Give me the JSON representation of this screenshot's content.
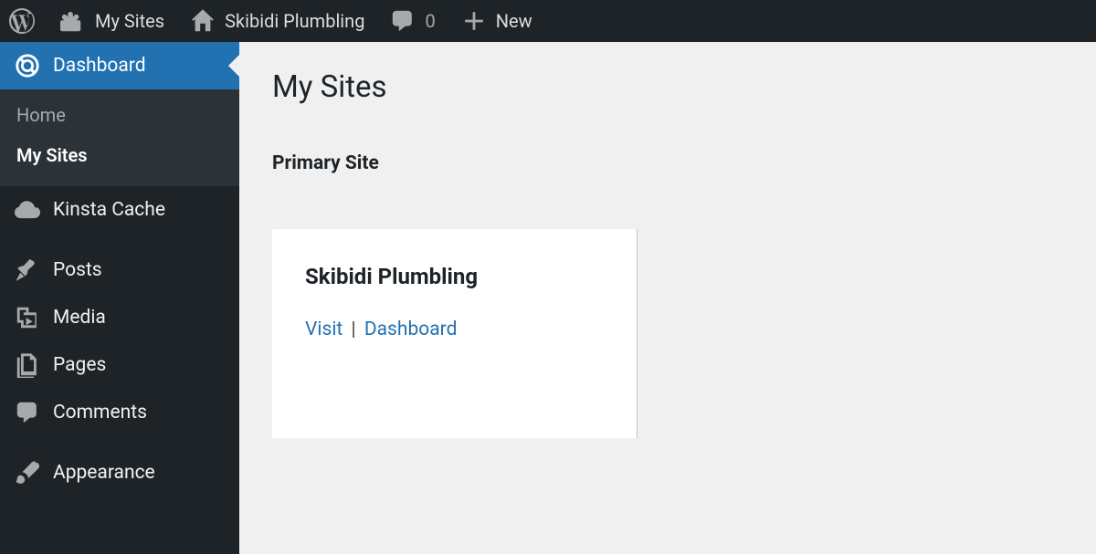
{
  "adminbar": {
    "my_sites": "My Sites",
    "site_name": "Skibidi Plumbling",
    "comments_count": "0",
    "new": "New"
  },
  "sidebar": {
    "dashboard": "Dashboard",
    "submenu": {
      "home": "Home",
      "my_sites": "My Sites"
    },
    "kinsta_cache": "Kinsta Cache",
    "posts": "Posts",
    "media": "Media",
    "pages": "Pages",
    "comments": "Comments",
    "appearance": "Appearance"
  },
  "content": {
    "title": "My Sites",
    "primary_heading": "Primary Site",
    "card": {
      "title": "Skibidi Plumbling",
      "visit": "Visit",
      "dashboard": "Dashboard"
    }
  }
}
